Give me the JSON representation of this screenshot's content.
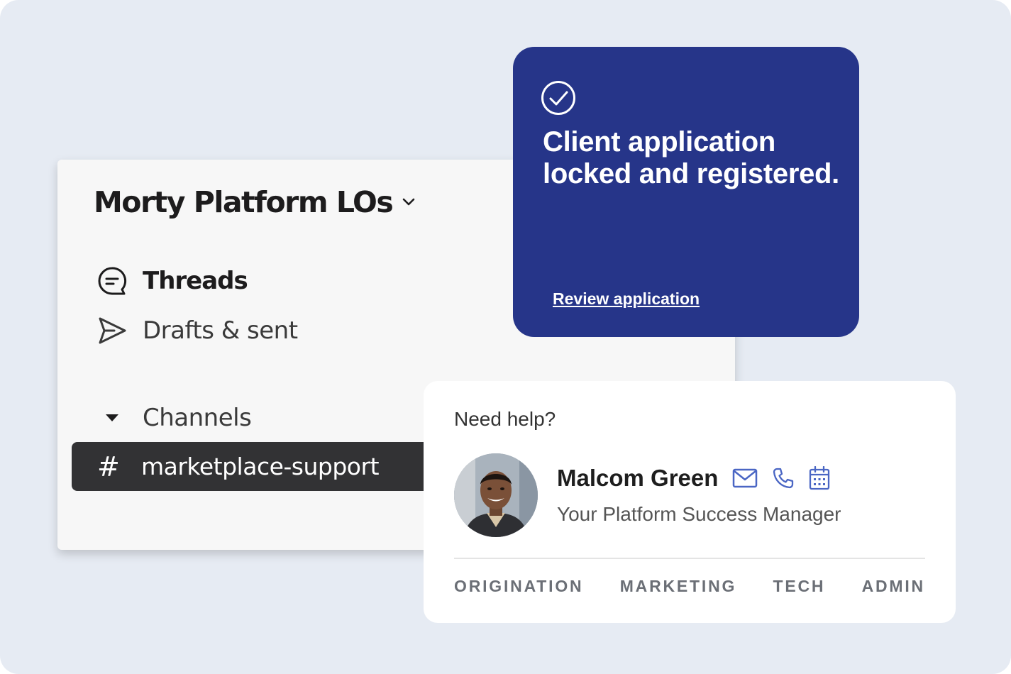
{
  "workspace": {
    "name": "Morty Platform LOs",
    "nav": [
      {
        "label": "Threads",
        "icon": "threads-icon"
      },
      {
        "label": "Drafts & sent",
        "icon": "send-icon"
      }
    ],
    "channels_section": {
      "label": "Channels",
      "icon": "caret-down-icon"
    },
    "active_channel": {
      "prefix": "#",
      "name": "marketplace-support"
    }
  },
  "notification": {
    "icon": "check-circle-icon",
    "message": "Client application locked and registered.",
    "link": "Review application",
    "background": "#263589"
  },
  "help_card": {
    "heading": "Need help?",
    "contact": {
      "name": "Malcom Green",
      "role": "Your Platform Success Manager",
      "icons": [
        "mail-icon",
        "phone-icon",
        "calendar-icon"
      ]
    },
    "tabs": [
      "ORIGINATION",
      "MARKETING",
      "TECH",
      "ADMIN"
    ]
  },
  "colors": {
    "background": "#e6ebf3",
    "accent": "#263589",
    "channel_highlight": "#323234",
    "contact_icon": "#4a66c4"
  }
}
